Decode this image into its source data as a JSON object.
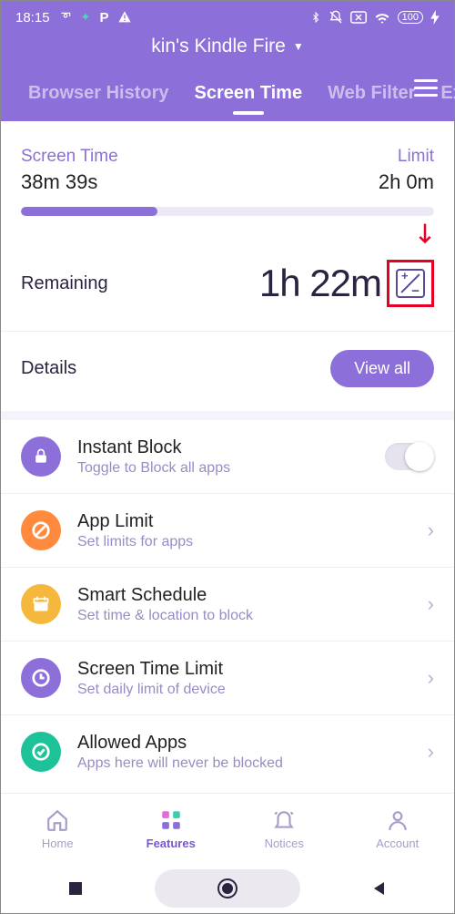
{
  "statusbar": {
    "time": "18:15",
    "battery": "100"
  },
  "header": {
    "title": "kin's Kindle Fire"
  },
  "tabs": {
    "browser_history": "Browser History",
    "screen_time": "Screen Time",
    "web_filter": "Web Filter",
    "extra": "Ex"
  },
  "screentime_card": {
    "left_label": "Screen Time",
    "right_label": "Limit",
    "used": "38m 39s",
    "limit": "2h 0m"
  },
  "remaining": {
    "label": "Remaining",
    "value": "1h 22m"
  },
  "details": {
    "label": "Details",
    "button": "View all"
  },
  "list": {
    "instant_block": {
      "title": "Instant Block",
      "sub": "Toggle to Block all apps"
    },
    "app_limit": {
      "title": "App Limit",
      "sub": "Set limits for apps"
    },
    "smart_schedule": {
      "title": "Smart Schedule",
      "sub": "Set time & location to block"
    },
    "screen_time_limit": {
      "title": "Screen Time Limit",
      "sub": "Set daily limit of device"
    },
    "allowed_apps": {
      "title": "Allowed Apps",
      "sub": "Apps here will never be blocked"
    }
  },
  "bottomnav": {
    "home": "Home",
    "features": "Features",
    "notices": "Notices",
    "account": "Account"
  }
}
